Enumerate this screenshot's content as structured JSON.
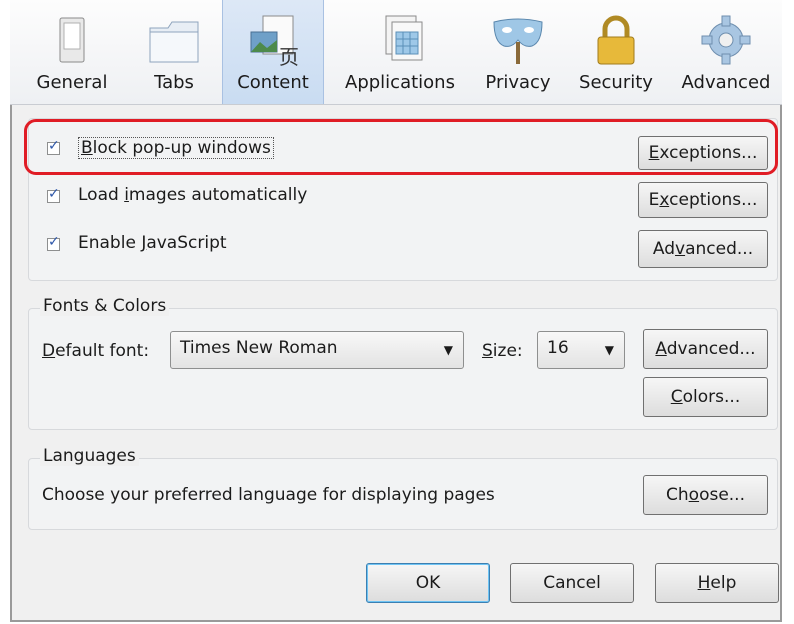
{
  "toolbar": {
    "tabs": [
      {
        "label": "General",
        "icon": "switch-icon"
      },
      {
        "label": "Tabs",
        "icon": "folder-tabs-icon"
      },
      {
        "label": "Content",
        "icon": "content-page-icon"
      },
      {
        "label": "Applications",
        "icon": "applications-grid-icon"
      },
      {
        "label": "Privacy",
        "icon": "privacy-mask-icon"
      },
      {
        "label": "Security",
        "icon": "padlock-icon"
      },
      {
        "label": "Advanced",
        "icon": "gear-icon"
      }
    ],
    "active_tab": "Content"
  },
  "content": {
    "popups": {
      "label_prefix": "",
      "label_accel": "B",
      "label_rest": "lock pop-up windows",
      "checked": true,
      "button": {
        "pre": "",
        "accel": "E",
        "post": "xceptions..."
      }
    },
    "images": {
      "label_pre": "Load ",
      "label_accel": "i",
      "label_post": "mages automatically",
      "checked": true,
      "button": {
        "pre": "E",
        "accel": "x",
        "post": "ceptions..."
      }
    },
    "javascript": {
      "label_pre": "Enable ",
      "label_accel": "J",
      "label_post": "avaScript",
      "checked": true,
      "button": {
        "pre": "Ad",
        "accel": "v",
        "post": "anced..."
      }
    }
  },
  "fonts": {
    "group_title": "Fonts & Colors",
    "default_font_label": {
      "pre": "",
      "accel": "D",
      "post": "efault font:"
    },
    "default_font_value": "Times New Roman",
    "size_label": {
      "pre": "",
      "accel": "S",
      "post": "ize:"
    },
    "size_value": "16",
    "advanced_button": {
      "pre": "",
      "accel": "A",
      "post": "dvanced..."
    },
    "colors_button": {
      "pre": "",
      "accel": "C",
      "post": "olors..."
    }
  },
  "languages": {
    "group_title": "Languages",
    "description": "Choose your preferred language for displaying pages",
    "choose_button": {
      "pre": "Ch",
      "accel": "o",
      "post": "ose..."
    }
  },
  "footer": {
    "ok": "OK",
    "cancel": "Cancel",
    "help": {
      "pre": "",
      "accel": "H",
      "post": "elp"
    }
  },
  "colors": {
    "highlight": "#e01c25",
    "active_tab": "#c9dcf2",
    "checkmark": "#2d56a8"
  }
}
